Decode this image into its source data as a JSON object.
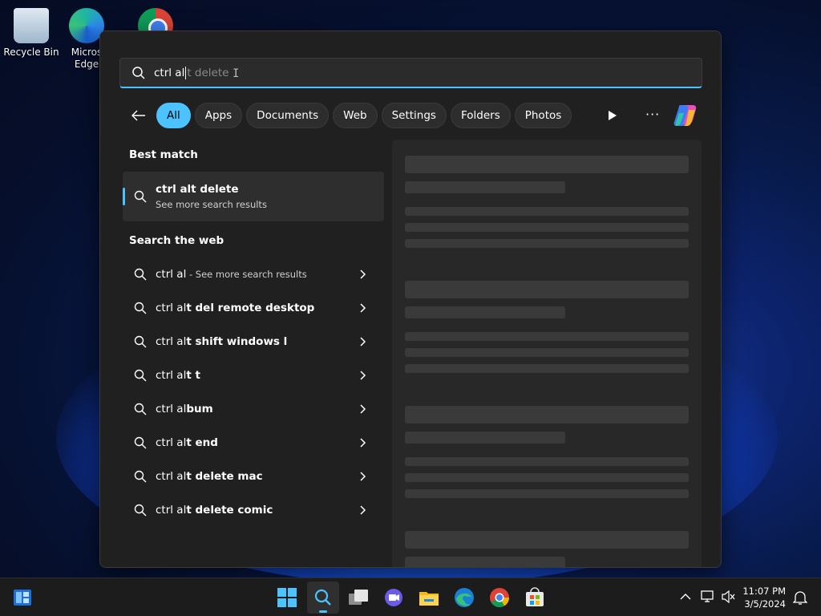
{
  "desktop": {
    "icons": [
      {
        "label": "Recycle Bin"
      },
      {
        "label": "Micros Edge"
      },
      {
        "label": ""
      }
    ]
  },
  "search": {
    "typed": "ctrl al",
    "suggestion": "t delete"
  },
  "filters": [
    "All",
    "Apps",
    "Documents",
    "Web",
    "Settings",
    "Folders",
    "Photos"
  ],
  "best_match": {
    "title": "Best match",
    "item_title": "ctrl alt delete",
    "item_subtitle": "See more search results"
  },
  "web": {
    "title": "Search the web",
    "items": [
      {
        "prefix": "ctrl al",
        "bold": "",
        "hint": " - See more search results"
      },
      {
        "prefix": "ctrl al",
        "bold": "t del remote desktop",
        "hint": ""
      },
      {
        "prefix": "ctrl al",
        "bold": "t shift windows l",
        "hint": ""
      },
      {
        "prefix": "ctrl al",
        "bold": "t t",
        "hint": ""
      },
      {
        "prefix": "ctrl al",
        "bold": "bum",
        "hint": ""
      },
      {
        "prefix": "ctrl al",
        "bold": "t end",
        "hint": ""
      },
      {
        "prefix": "ctrl al",
        "bold": "t delete mac",
        "hint": ""
      },
      {
        "prefix": "ctrl al",
        "bold": "t delete comic",
        "hint": ""
      }
    ]
  },
  "taskbar": {
    "time": "11:07 PM",
    "date": "3/5/2024"
  },
  "colors": {
    "accent": "#4cc2ff",
    "panel": "#202020"
  }
}
